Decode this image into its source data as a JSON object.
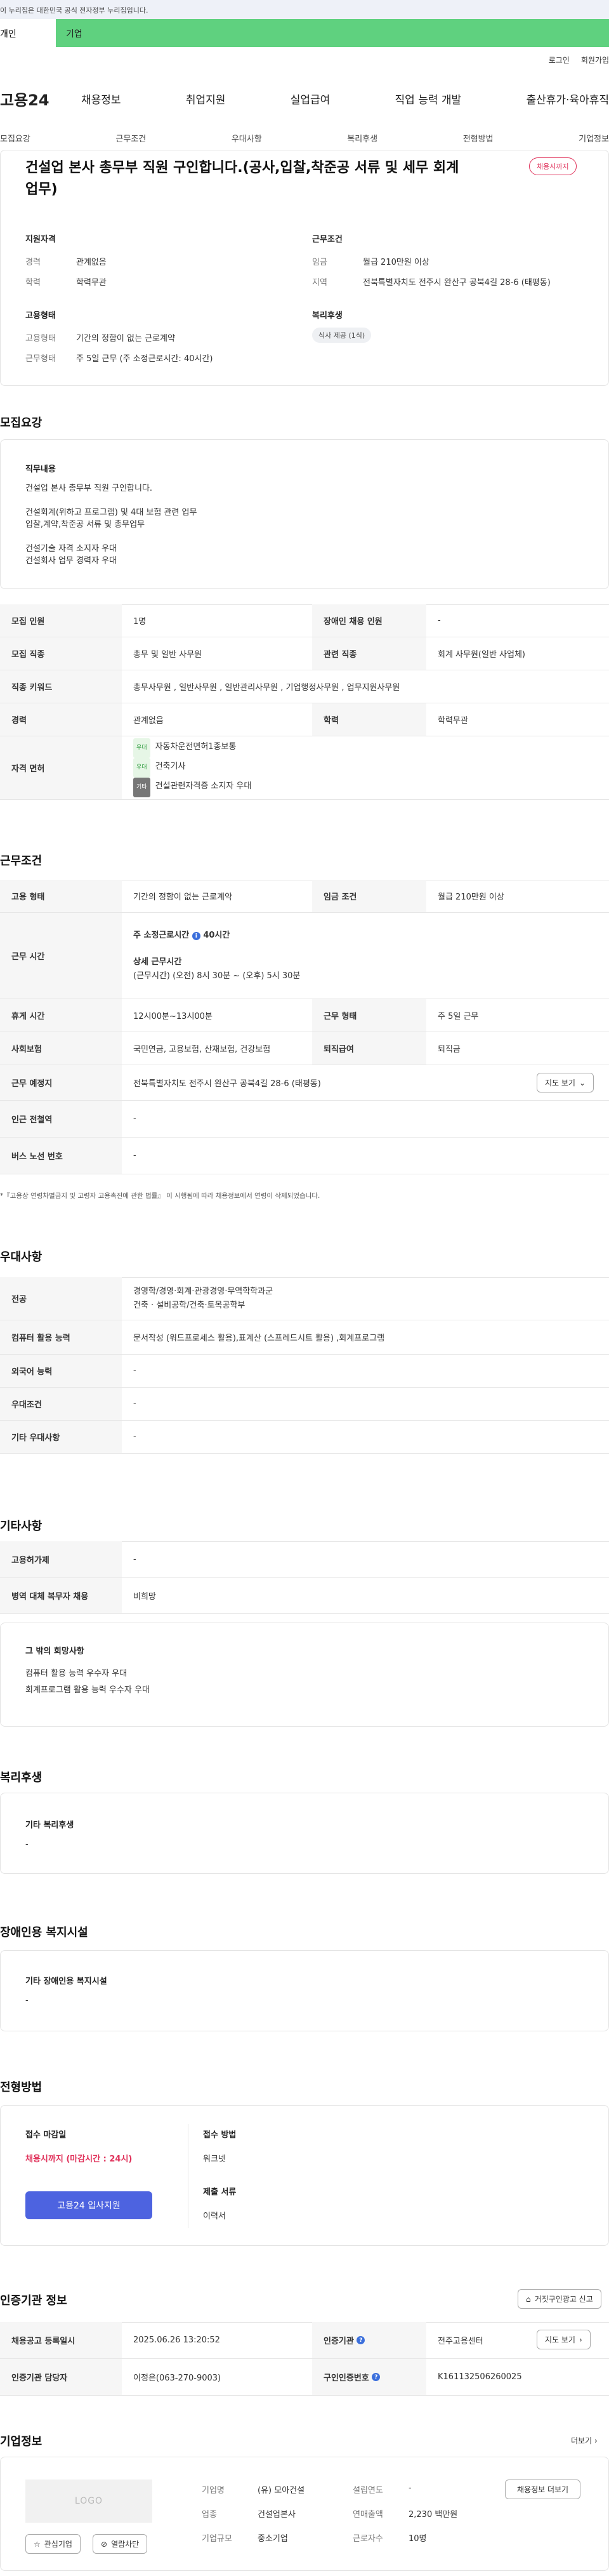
{
  "gov_banner": "이 누리집은 대한민국 공식 전자정부 누리집입니다.",
  "tabs": {
    "personal": "개인",
    "company": "기업"
  },
  "util": {
    "login": "로그인",
    "join": "회원가입"
  },
  "logo": "고용24",
  "gnb": [
    "채용정보",
    "취업지원",
    "실업급여",
    "직업 능력 개발",
    "출산휴가·육아휴직"
  ],
  "subnav": [
    "모집요강",
    "근무조건",
    "우대사항",
    "복리후생",
    "전형방법",
    "기업정보"
  ],
  "job": {
    "title_line1": "건설업 본사 총무부 직원 구인합니다.(공사,입찰,착준공 서류 및 세무 회계",
    "title_line2": "업무)",
    "badge": "채용시까지",
    "qual_head": "지원자격",
    "career_k": "경력",
    "career_v": "관계없음",
    "edu_k": "학력",
    "edu_v": "학력무관",
    "work_head": "근무조건",
    "wage_k": "임금",
    "wage_v": "월급 210만원 이상",
    "area_k": "지역",
    "area_v": "전북특별자치도 전주시 완산구 공북4길 28-6 (태평동)",
    "emp_head": "고용형태",
    "emptype_k": "고용형태",
    "emptype_v": "기간의 정함이 없는 근로계약",
    "workform_k": "근무형태",
    "workform_v": "주 5일 근무 (주 소정근로시간: 40시간)",
    "welfare_head": "복리후생",
    "welfare_chip": "식사 제공 (1식)"
  },
  "recruit": {
    "sec": "모집요강",
    "duty_head": "직무내용",
    "duty_lines": [
      "건설업 본사 총무부 직원 구인합니다.",
      "",
      "건설회계(위하고 프로그램) 및 4대 보험 관련 업무",
      "입찰,계약,착준공 서류 및 총무업무",
      "",
      "건설기술 자격 소지자 우대",
      "건설회사 업무 경력자 우대"
    ],
    "r1": {
      "k1": "모집 인원",
      "v1": "1명",
      "k2": "장애인 채용 인원",
      "v2": "-"
    },
    "r2": {
      "k1": "모집 직종",
      "v1": "총무 및 일반 사무원",
      "k2": "관련 직종",
      "v2": "회계 사무원(일반 사업체)"
    },
    "r3": {
      "k1": "직종 키워드",
      "v1": "총무사무원 , 일반사무원 , 일반관리사무원 , 기업행정사무원 , 업무지원사무원"
    },
    "r4": {
      "k1": "경력",
      "v1": "관계없음",
      "k2": "학력",
      "v2": "학력무관"
    },
    "r5": {
      "k1": "자격 면허",
      "items": [
        {
          "tag": "우대",
          "text": "자동차운전면허1종보통"
        },
        {
          "tag": "우대",
          "text": "건축기사"
        },
        {
          "tag": "기타",
          "text": "건설관련자격증 소지자 우대"
        }
      ]
    }
  },
  "cond": {
    "sec": "근무조건",
    "emp": {
      "k1": "고용 형태",
      "v1": "기간의 정함이 없는 근로계약",
      "k2": "임금 조건",
      "v2": "월급 210만원 이상"
    },
    "hours_k": "근무 시간",
    "hours_week": "주 소정근로시간",
    "hours_week_v": "40시간",
    "hours_detail_h": "상세 근무시간",
    "hours_detail_v": "(근무시간) (오전) 8시 30분 ~ (오후) 5시 30분",
    "rest": {
      "k1": "휴게 시간",
      "v1": "12시00분~13시00분",
      "k2": "근무 형태",
      "v2": "주 5일 근무"
    },
    "ins": {
      "k1": "사회보험",
      "v1": "국민연금, 고용보험, 산재보험, 건강보험",
      "k2": "퇴직급여",
      "v2": "퇴직금"
    },
    "place": {
      "k1": "근무 예정지",
      "v1": "전북특별자치도 전주시 완산구 공북4길 28-6 (태평동)",
      "map": "지도 보기"
    },
    "station": {
      "k1": "인근 전철역",
      "v1": "-"
    },
    "bus": {
      "k1": "버스 노선 번호",
      "v1": "-"
    },
    "note": "*『고용상 연령차별금지 및 고령자 고용촉진에 관한 법률』 이 시행됨에 따라 채용정보에서 연령이 삭제되었습니다."
  },
  "pref": {
    "sec": "우대사항",
    "major": {
      "k": "전공",
      "v1": "경영학/경영·회계·관광경영·무역학학과군",
      "v2": "건축 · 설비공학/건축·토목공학부"
    },
    "pc": {
      "k": "컴퓨터 활용 능력",
      "v": "문서작성 (워드프로세스 활용),표계산 (스프레드시트 활용) ,회계프로그램"
    },
    "lang": {
      "k": "외국어 능력",
      "v": "-"
    },
    "cond": {
      "k": "우대조건",
      "v": "-"
    },
    "etc": {
      "k": "기타 우대사항",
      "v": "-"
    }
  },
  "other": {
    "sec": "기타사항",
    "insurance": {
      "k": "고용허가제",
      "v": "-"
    },
    "military": {
      "k": "병역 대체 복무자 채용",
      "v": "비희망"
    },
    "hope_h": "그 밖의 희망사항",
    "hope_lines": [
      "컴퓨터 활용 능력 우수자 우대",
      "회계프로그램 활용 능력 우수자 우대"
    ]
  },
  "welfare": {
    "sec": "복리후생",
    "box_h": "기타 복리후생",
    "box_v": "-"
  },
  "disab": {
    "sec": "장애인용 복지시설",
    "box_h": "기타 장애인용 복지시설",
    "box_v": "-"
  },
  "process": {
    "sec": "전형방법",
    "deadline_h": "접수 마감일",
    "deadline_v": "채용시까지 (마감시간 : 24시)",
    "apply_btn": "고용24 입사지원",
    "method_h": "접수 방법",
    "method_v": "워크넷",
    "docs_h": "제출 서류",
    "docs_v": "이력서"
  },
  "cert": {
    "sec": "인증기관 정보",
    "dispute_btn": "거짓구인광고 신고",
    "r1": {
      "k1": "채용공고 등록일시",
      "v1": "2025.06.26 13:20:52",
      "k2": "인증기관",
      "v2": "전주고용센터",
      "map": "지도 보기"
    },
    "r2": {
      "k1": "인증기관 담당자",
      "v1": "이정은(063-270-9003)",
      "k2": "구인인증번호",
      "v2": "K161132506260025"
    }
  },
  "company": {
    "sec": "기업정보",
    "more": "더보기",
    "logo": "LOGO",
    "fav_btn": "관심기업",
    "block_btn": "열람차단",
    "name_k": "기업명",
    "name_v": "(유) 모아건설",
    "year_k": "설립연도",
    "year_v": "-",
    "ind_k": "업종",
    "ind_v": "건설업본사",
    "sales_k": "연매출액",
    "sales_v": "2,230 백만원",
    "size_k": "기업규모",
    "size_v": "중소기업",
    "emp_k": "근로자수",
    "emp_v": "10명",
    "jobs_btn": "채용정보 더보기"
  }
}
